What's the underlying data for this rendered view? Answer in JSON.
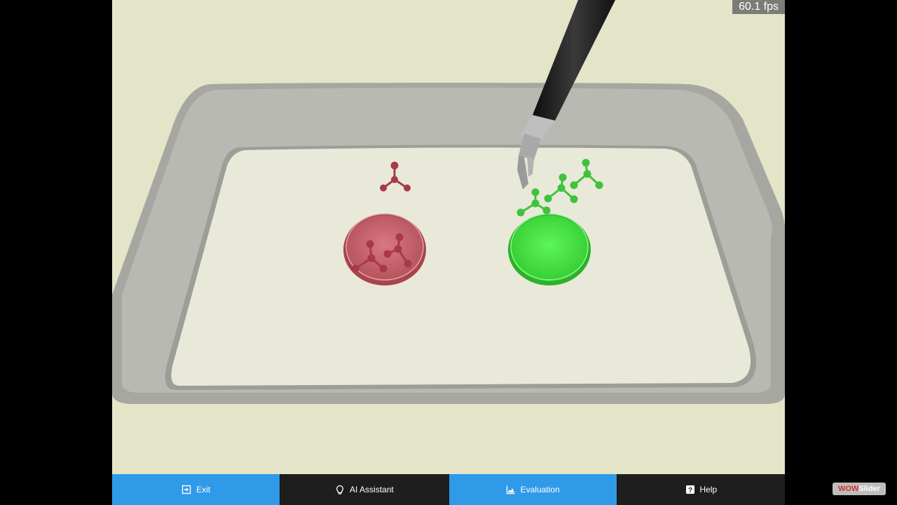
{
  "stats": {
    "fps": "60.1 fps"
  },
  "toolbar": {
    "exit_label": "Exit",
    "ai_label": "AI Assistant",
    "evaluation_label": "Evaluation",
    "help_label": "Help"
  },
  "watermark": {
    "part1": "WOW",
    "part2": "Slider"
  },
  "scene": {
    "colors": {
      "background": "#e4e4c9",
      "tray": "#a7a8a2",
      "red_target": "#c8656e",
      "green_target": "#48e445",
      "red_objects": "#a83a48",
      "green_objects": "#3fc23d",
      "instrument": "#1f1f1f"
    }
  }
}
